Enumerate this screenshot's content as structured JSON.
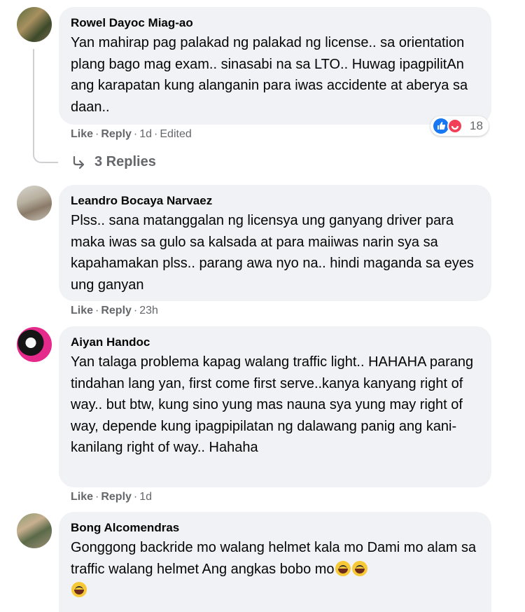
{
  "comments": [
    {
      "author": "Rowel Dayoc Miag-ao",
      "text": "Yan mahirap pag palakad ng palakad ng license.. sa orientation plang bago mag exam.. sinasabi na sa LTO.. Huwag ipagpilitAn ang karapatan kung alanganin para iwas accidente at aberya sa daan..",
      "like": "Like",
      "reply": "Reply",
      "time": "1d",
      "edited": "Edited",
      "reaction_count": "18",
      "replies": "3 Replies"
    },
    {
      "author": "Leandro Bocaya Narvaez",
      "text": "Plss.. sana matanggalan ng licensya ung ganyang driver para maka iwas sa gulo sa kalsada at para maiiwas narin sya sa kapahamakan plss.. parang awa nyo na.. hindi maganda sa eyes ung ganyan",
      "like": "Like",
      "reply": "Reply",
      "time": "23h"
    },
    {
      "author": "Aiyan Handoc",
      "text": "Yan talaga problema kapag walang traffic light.. HAHAHA parang tindahan lang yan, first come first serve..kanya kanyang right of way.. but btw, kung sino yung mas nauna sya yung may right of way, depende kung ipagpipilatan ng dalawang panig ang kani-kanilang right of way.. Hahaha",
      "like": "Like",
      "reply": "Reply",
      "time": "1d"
    },
    {
      "author": "Bong Alcomendras",
      "text": "Gonggong backride mo walang helmet kala mo Dami mo alam sa traffic walang helmet Ang angkas bobo mo"
    }
  ]
}
